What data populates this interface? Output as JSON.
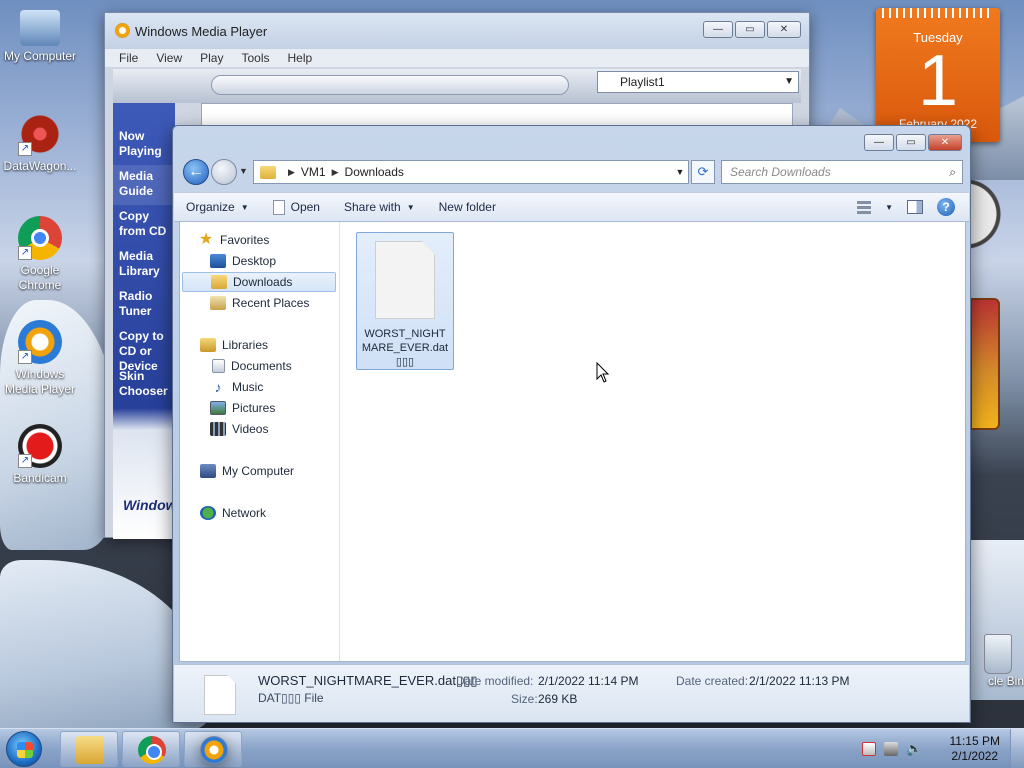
{
  "desktop": {
    "icons": [
      {
        "label": "My Computer"
      },
      {
        "label": "DataWagon..."
      },
      {
        "label": "Google Chrome"
      },
      {
        "label": "Windows Media Player"
      },
      {
        "label": "Bandicam"
      }
    ],
    "recycle_bin_label": "cle Bin"
  },
  "calendar_gadget": {
    "day_of_week": "Tuesday",
    "day": "1",
    "month_year": "February 2022"
  },
  "wmp": {
    "title": "Windows Media Player",
    "menu": [
      "File",
      "View",
      "Play",
      "Tools",
      "Help"
    ],
    "playlist": "Playlist1",
    "sidebar": [
      "Now Playing",
      "Media Guide",
      "Copy from CD",
      "Media Library",
      "Radio Tuner",
      "Copy to CD or Device",
      "Skin Chooser"
    ],
    "logo_text": "Windows Media Player"
  },
  "explorer": {
    "breadcrumb": [
      "VM1",
      "Downloads"
    ],
    "search_placeholder": "Search Downloads",
    "commands": {
      "organize": "Organize",
      "open": "Open",
      "share_with": "Share with",
      "new_folder": "New folder"
    },
    "nav": {
      "favorites": "Favorites",
      "desktop": "Desktop",
      "downloads": "Downloads",
      "recent_places": "Recent Places",
      "libraries": "Libraries",
      "documents": "Documents",
      "music": "Music",
      "pictures": "Pictures",
      "videos": "Videos",
      "my_computer": "My Computer",
      "network": "Network"
    },
    "files": [
      {
        "name": "WORST_NIGHTMARE_EVER.dat▯▯▯"
      }
    ],
    "details": {
      "name": "WORST_NIGHTMARE_EVER.dat▯▯▯",
      "type": "DAT▯▯▯ File",
      "date_modified_label": "Date modified:",
      "date_modified": "2/1/2022 11:14 PM",
      "size_label": "Size:",
      "size": "269 KB",
      "date_created_label": "Date created:",
      "date_created": "2/1/2022 11:13 PM"
    }
  },
  "taskbar": {
    "time": "11:15 PM",
    "date": "2/1/2022"
  }
}
